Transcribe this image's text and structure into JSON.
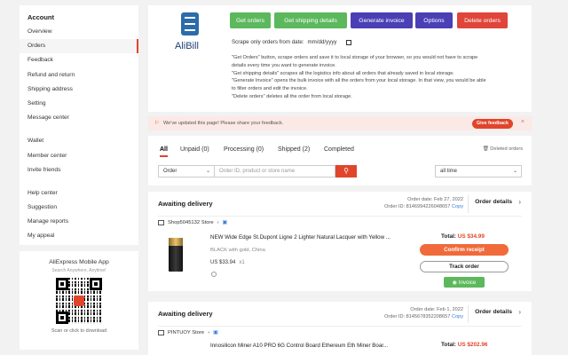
{
  "sidebar": {
    "heading": "Account",
    "group1": [
      "Overview",
      "Orders",
      "Feedback",
      "Refund and return",
      "Shipping address",
      "Setting",
      "Message center"
    ],
    "group2": [
      "Wallet",
      "Member center",
      "Invite friends"
    ],
    "group3": [
      "Help center",
      "Suggestion",
      "Manage reports",
      "My appeal"
    ],
    "active": "Orders"
  },
  "app_promo": {
    "title": "AliExpress Mobile App",
    "subtitle": "Search Anywhere, Anytime!",
    "caption": "Scan or click to download"
  },
  "alibill": {
    "logo_text": "AliBill",
    "buttons": {
      "get_orders": "Get orders",
      "get_shipping": "Get shipping details",
      "generate_invoice": "Generate invoice",
      "options": "Options",
      "delete_orders": "Delete orders"
    },
    "scrape_label": "Scrape only orders from date:",
    "date_placeholder": "mm/dd/yyyy",
    "description": [
      "\"Get Orders\" button, scrape orders and save it to local storage of your browser, so you would not have to scrape",
      "details every time you want to generate invoice.",
      "\"Get shipping details\" scrapes all the logistics info about all orders that already saved in local storage.",
      "\"Generate Invoice\" opens the bulk invoice with all the orders from your local storage. In that view, you would be able",
      "to filter orders and edit the invoice.",
      "\"Delete orders\" deletes all the order from local storage."
    ]
  },
  "feedback_bar": {
    "text": "We've updated this page! Please share your feedback.",
    "button": "Give feedback"
  },
  "orders": {
    "tabs": [
      "All",
      "Unpaid (0)",
      "Processing (0)",
      "Shipped (2)",
      "Completed"
    ],
    "deleted_link": "Deleted orders",
    "filter_select": "Order",
    "search_placeholder": "Order ID, product or store name",
    "time_select": "all time"
  },
  "cards": [
    {
      "status": "Awaiting delivery",
      "order_date": "Order date: Feb 27, 2022",
      "order_id": "Order ID: 8146994226048657",
      "copy": "Copy",
      "details": "Order details",
      "store": "Shop5045132 Store",
      "product_title": "NEW Wide Edge St.Dupont Ligne 2 Lighter Natural Lacquer with Yellow ...",
      "variant": "BLACK with gold, China",
      "price": "US $33.94",
      "qty": "x1",
      "total_label": "Total:",
      "total_amount": "US $34.99",
      "confirm": "Confirm receipt",
      "track": "Track order",
      "invoice": "Invoice"
    },
    {
      "status": "Awaiting delivery",
      "order_date": "Order date: Feb 1, 2022",
      "order_id": "Order ID: 8145678352208657",
      "copy": "Copy",
      "details": "Order details",
      "store": "PINTUOY Store",
      "product_title": "Innosilicon Miner A10 PRO 6G Control Board Ethereum Eth Miner Boar...",
      "total_label": "Total:",
      "total_amount": "US $202.96"
    }
  ],
  "icons": {
    "alibill_logo": "document-icon",
    "search": "search-icon",
    "calendar": "calendar-icon"
  },
  "colors": {
    "accent": "#e0452b",
    "green": "#5cb85c",
    "purple": "#4a3fb5",
    "red": "#e0453a",
    "link": "#3b7dd8"
  }
}
